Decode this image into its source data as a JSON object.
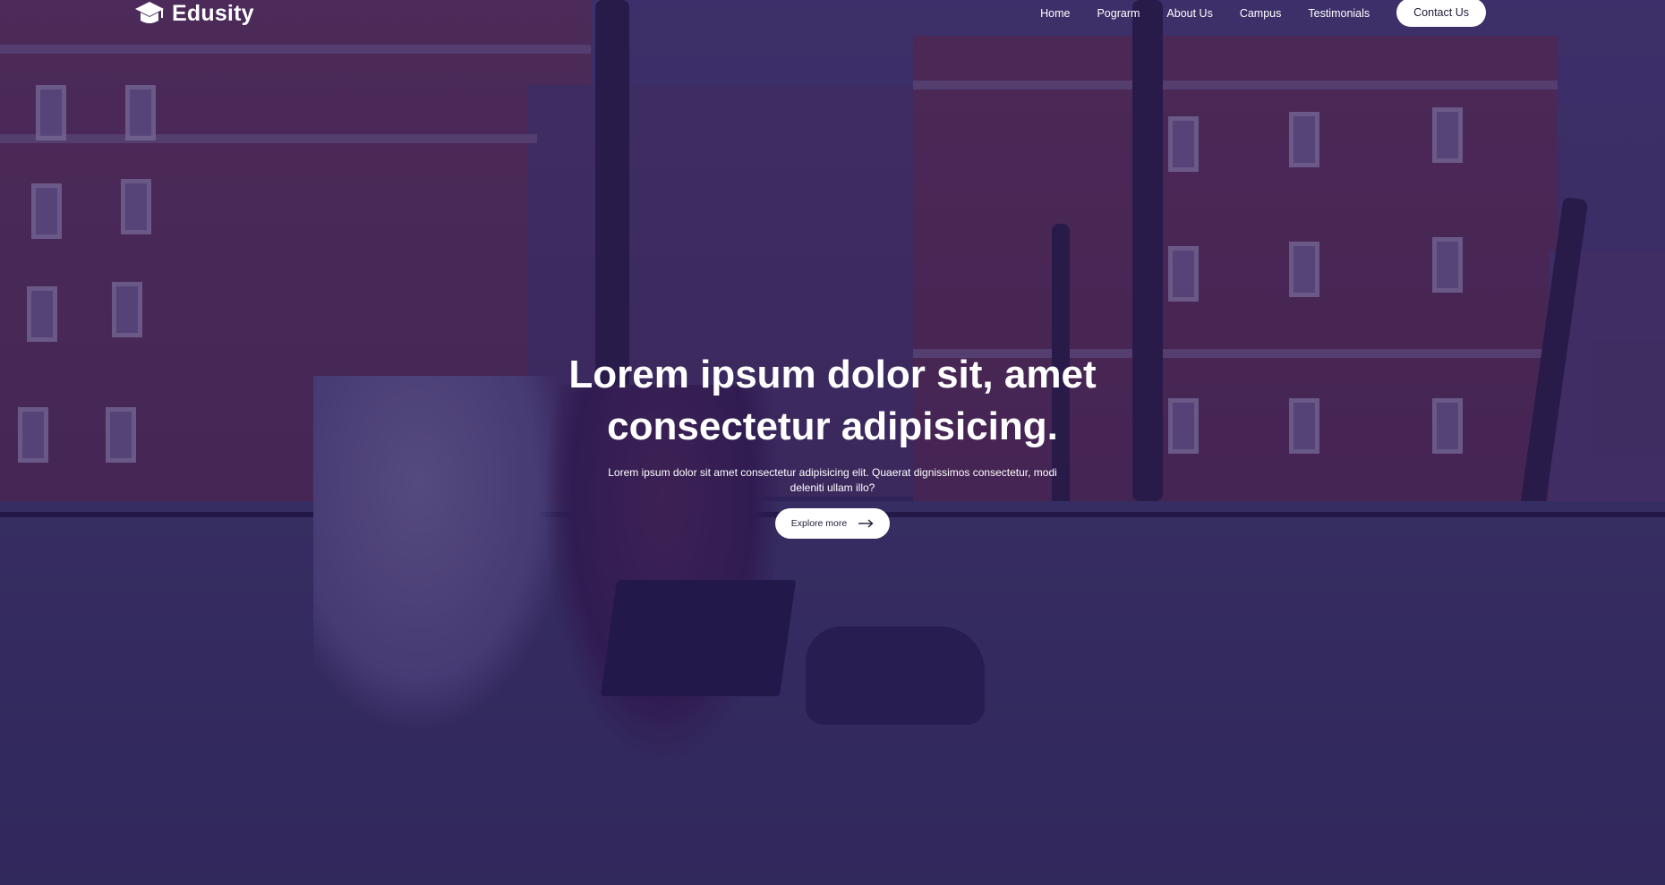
{
  "brand": {
    "name": "Edusity",
    "logo_icon": "graduation-cap-icon"
  },
  "nav": {
    "items": [
      {
        "label": "Home"
      },
      {
        "label": "Pograrm"
      },
      {
        "label": "About Us"
      },
      {
        "label": "Campus"
      },
      {
        "label": "Testimonials"
      }
    ],
    "contact_label": "Contact Us"
  },
  "hero": {
    "title_line1": "Lorem ipsum dolor sit, amet",
    "title_line2": "consectetur adipisicing.",
    "subtitle": "Lorem ipsum dolor sit amet consectetur adipisicing elit. Quaerat dignissimos consectetur, modi deleniti ullam illo?",
    "cta_label": "Explore more",
    "cta_icon": "arrow-right-icon"
  },
  "colors": {
    "overlay": "#26165c",
    "button_bg": "#ffffff",
    "button_text": "#1f1a3a",
    "text": "#ffffff"
  }
}
